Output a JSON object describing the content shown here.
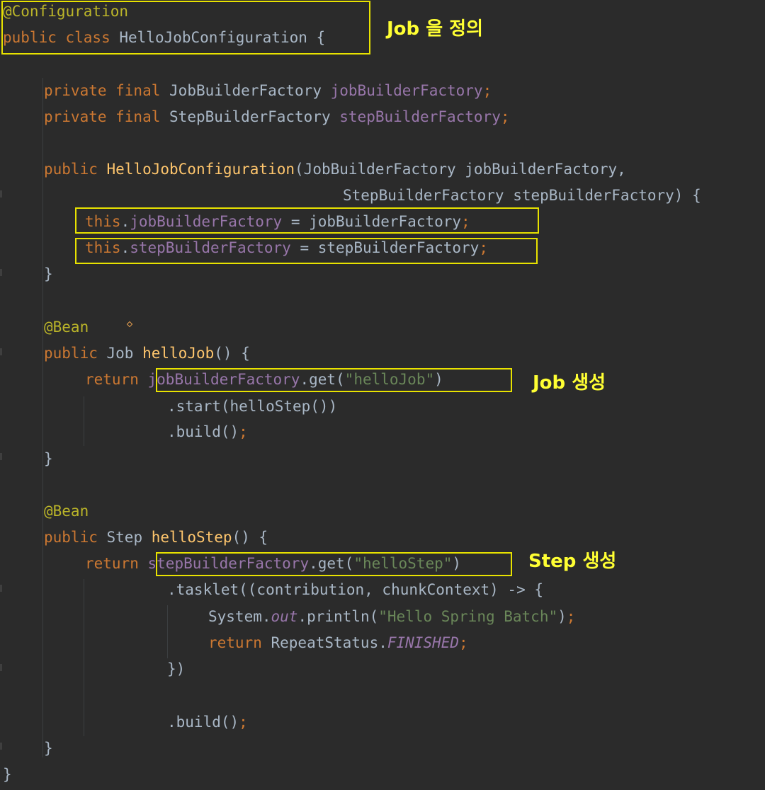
{
  "code": {
    "l1": {
      "ann": "@Configuration"
    },
    "l2": {
      "kw": "public class",
      "name": "HelloJobConfiguration",
      "brace": "{"
    },
    "l3": {
      "kw": "private final",
      "type": "JobBuilderFactory",
      "field": "jobBuilderFactory",
      "semi": ";"
    },
    "l4": {
      "kw": "private final",
      "type": "StepBuilderFactory",
      "field": "stepBuilderFactory",
      "semi": ";"
    },
    "l5": {
      "kw": "public",
      "name": "HelloJobConfiguration",
      "rest": "(JobBuilderFactory jobBuilderFactory,"
    },
    "l6": {
      "rest": "StepBuilderFactory stepBuilderFactory) {"
    },
    "l7": {
      "kw": "this",
      "dot": ".",
      "field": "jobBuilderFactory",
      "rest": " = jobBuilderFactory",
      "semi": ";"
    },
    "l8": {
      "kw": "this",
      "dot": ".",
      "field": "stepBuilderFactory",
      "rest": " = stepBuilderFactory",
      "semi": ";"
    },
    "l9": {
      "rest": "}"
    },
    "l10": {
      "ann": "@Bean"
    },
    "l11": {
      "kw": "public",
      "type": "Job",
      "name": "helloJob",
      "rest": "() {"
    },
    "l12": {
      "kw": "return",
      "field": "jobBuilderFactory",
      "rest": ".get(",
      "str": "\"helloJob\"",
      "close": ")"
    },
    "l13": {
      "rest": ".start(helloStep())"
    },
    "l14": {
      "rest": ".build()",
      "semi": ";"
    },
    "l15": {
      "rest": "}"
    },
    "l16": {
      "ann": "@Bean"
    },
    "l17": {
      "kw": "public",
      "type": "Step",
      "name": "helloStep",
      "rest": "() {"
    },
    "l18": {
      "kw": "return",
      "field": "stepBuilderFactory",
      "rest": ".get(",
      "str": "\"helloStep\"",
      "close": ")"
    },
    "l19": {
      "rest": ".tasklet((contribution, chunkContext) -> {"
    },
    "l20": {
      "pre": "System.",
      "field": "out",
      "rest": ".println(",
      "str": "\"Hello Spring Batch\"",
      "close": ")",
      "semi": ";"
    },
    "l21": {
      "kw": "return",
      "rest": " RepeatStatus.",
      "field": "FINISHED",
      "semi": ";"
    },
    "l22": {
      "rest": "})"
    },
    "l23": {
      "rest": ".build()",
      "semi": ";"
    },
    "l24": {
      "rest": "}"
    },
    "l25": {
      "rest": "}"
    }
  },
  "annotations": {
    "define_job": "Job 을 정의",
    "create_job": "Job 생성",
    "create_step": "Step 생성"
  },
  "colors": {
    "background": "#2b2b2b",
    "keyword": "#cc7832",
    "annotation": "#bbb529",
    "method": "#ffc66d",
    "field": "#9876aa",
    "string": "#6a8759",
    "text": "#a9b7c6",
    "highlight": "#e8e200",
    "note": "#ffff33"
  }
}
